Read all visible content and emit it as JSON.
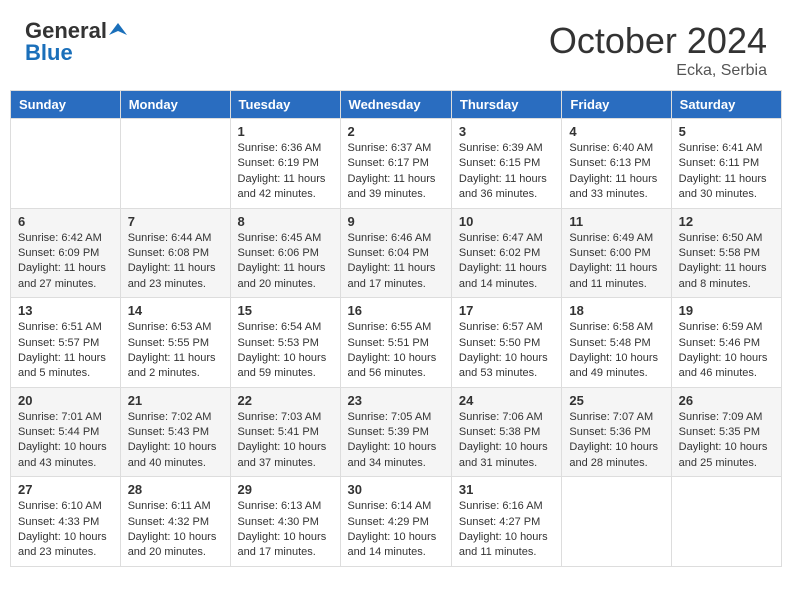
{
  "header": {
    "logo_general": "General",
    "logo_blue": "Blue",
    "month_title": "October 2024",
    "location": "Ecka, Serbia"
  },
  "calendar": {
    "days_of_week": [
      "Sunday",
      "Monday",
      "Tuesday",
      "Wednesday",
      "Thursday",
      "Friday",
      "Saturday"
    ],
    "weeks": [
      [
        {
          "day": "",
          "sunrise": "",
          "sunset": "",
          "daylight": ""
        },
        {
          "day": "",
          "sunrise": "",
          "sunset": "",
          "daylight": ""
        },
        {
          "day": "1",
          "sunrise": "Sunrise: 6:36 AM",
          "sunset": "Sunset: 6:19 PM",
          "daylight": "Daylight: 11 hours and 42 minutes."
        },
        {
          "day": "2",
          "sunrise": "Sunrise: 6:37 AM",
          "sunset": "Sunset: 6:17 PM",
          "daylight": "Daylight: 11 hours and 39 minutes."
        },
        {
          "day": "3",
          "sunrise": "Sunrise: 6:39 AM",
          "sunset": "Sunset: 6:15 PM",
          "daylight": "Daylight: 11 hours and 36 minutes."
        },
        {
          "day": "4",
          "sunrise": "Sunrise: 6:40 AM",
          "sunset": "Sunset: 6:13 PM",
          "daylight": "Daylight: 11 hours and 33 minutes."
        },
        {
          "day": "5",
          "sunrise": "Sunrise: 6:41 AM",
          "sunset": "Sunset: 6:11 PM",
          "daylight": "Daylight: 11 hours and 30 minutes."
        }
      ],
      [
        {
          "day": "6",
          "sunrise": "Sunrise: 6:42 AM",
          "sunset": "Sunset: 6:09 PM",
          "daylight": "Daylight: 11 hours and 27 minutes."
        },
        {
          "day": "7",
          "sunrise": "Sunrise: 6:44 AM",
          "sunset": "Sunset: 6:08 PM",
          "daylight": "Daylight: 11 hours and 23 minutes."
        },
        {
          "day": "8",
          "sunrise": "Sunrise: 6:45 AM",
          "sunset": "Sunset: 6:06 PM",
          "daylight": "Daylight: 11 hours and 20 minutes."
        },
        {
          "day": "9",
          "sunrise": "Sunrise: 6:46 AM",
          "sunset": "Sunset: 6:04 PM",
          "daylight": "Daylight: 11 hours and 17 minutes."
        },
        {
          "day": "10",
          "sunrise": "Sunrise: 6:47 AM",
          "sunset": "Sunset: 6:02 PM",
          "daylight": "Daylight: 11 hours and 14 minutes."
        },
        {
          "day": "11",
          "sunrise": "Sunrise: 6:49 AM",
          "sunset": "Sunset: 6:00 PM",
          "daylight": "Daylight: 11 hours and 11 minutes."
        },
        {
          "day": "12",
          "sunrise": "Sunrise: 6:50 AM",
          "sunset": "Sunset: 5:58 PM",
          "daylight": "Daylight: 11 hours and 8 minutes."
        }
      ],
      [
        {
          "day": "13",
          "sunrise": "Sunrise: 6:51 AM",
          "sunset": "Sunset: 5:57 PM",
          "daylight": "Daylight: 11 hours and 5 minutes."
        },
        {
          "day": "14",
          "sunrise": "Sunrise: 6:53 AM",
          "sunset": "Sunset: 5:55 PM",
          "daylight": "Daylight: 11 hours and 2 minutes."
        },
        {
          "day": "15",
          "sunrise": "Sunrise: 6:54 AM",
          "sunset": "Sunset: 5:53 PM",
          "daylight": "Daylight: 10 hours and 59 minutes."
        },
        {
          "day": "16",
          "sunrise": "Sunrise: 6:55 AM",
          "sunset": "Sunset: 5:51 PM",
          "daylight": "Daylight: 10 hours and 56 minutes."
        },
        {
          "day": "17",
          "sunrise": "Sunrise: 6:57 AM",
          "sunset": "Sunset: 5:50 PM",
          "daylight": "Daylight: 10 hours and 53 minutes."
        },
        {
          "day": "18",
          "sunrise": "Sunrise: 6:58 AM",
          "sunset": "Sunset: 5:48 PM",
          "daylight": "Daylight: 10 hours and 49 minutes."
        },
        {
          "day": "19",
          "sunrise": "Sunrise: 6:59 AM",
          "sunset": "Sunset: 5:46 PM",
          "daylight": "Daylight: 10 hours and 46 minutes."
        }
      ],
      [
        {
          "day": "20",
          "sunrise": "Sunrise: 7:01 AM",
          "sunset": "Sunset: 5:44 PM",
          "daylight": "Daylight: 10 hours and 43 minutes."
        },
        {
          "day": "21",
          "sunrise": "Sunrise: 7:02 AM",
          "sunset": "Sunset: 5:43 PM",
          "daylight": "Daylight: 10 hours and 40 minutes."
        },
        {
          "day": "22",
          "sunrise": "Sunrise: 7:03 AM",
          "sunset": "Sunset: 5:41 PM",
          "daylight": "Daylight: 10 hours and 37 minutes."
        },
        {
          "day": "23",
          "sunrise": "Sunrise: 7:05 AM",
          "sunset": "Sunset: 5:39 PM",
          "daylight": "Daylight: 10 hours and 34 minutes."
        },
        {
          "day": "24",
          "sunrise": "Sunrise: 7:06 AM",
          "sunset": "Sunset: 5:38 PM",
          "daylight": "Daylight: 10 hours and 31 minutes."
        },
        {
          "day": "25",
          "sunrise": "Sunrise: 7:07 AM",
          "sunset": "Sunset: 5:36 PM",
          "daylight": "Daylight: 10 hours and 28 minutes."
        },
        {
          "day": "26",
          "sunrise": "Sunrise: 7:09 AM",
          "sunset": "Sunset: 5:35 PM",
          "daylight": "Daylight: 10 hours and 25 minutes."
        }
      ],
      [
        {
          "day": "27",
          "sunrise": "Sunrise: 6:10 AM",
          "sunset": "Sunset: 4:33 PM",
          "daylight": "Daylight: 10 hours and 23 minutes."
        },
        {
          "day": "28",
          "sunrise": "Sunrise: 6:11 AM",
          "sunset": "Sunset: 4:32 PM",
          "daylight": "Daylight: 10 hours and 20 minutes."
        },
        {
          "day": "29",
          "sunrise": "Sunrise: 6:13 AM",
          "sunset": "Sunset: 4:30 PM",
          "daylight": "Daylight: 10 hours and 17 minutes."
        },
        {
          "day": "30",
          "sunrise": "Sunrise: 6:14 AM",
          "sunset": "Sunset: 4:29 PM",
          "daylight": "Daylight: 10 hours and 14 minutes."
        },
        {
          "day": "31",
          "sunrise": "Sunrise: 6:16 AM",
          "sunset": "Sunset: 4:27 PM",
          "daylight": "Daylight: 10 hours and 11 minutes."
        },
        {
          "day": "",
          "sunrise": "",
          "sunset": "",
          "daylight": ""
        },
        {
          "day": "",
          "sunrise": "",
          "sunset": "",
          "daylight": ""
        }
      ]
    ]
  }
}
